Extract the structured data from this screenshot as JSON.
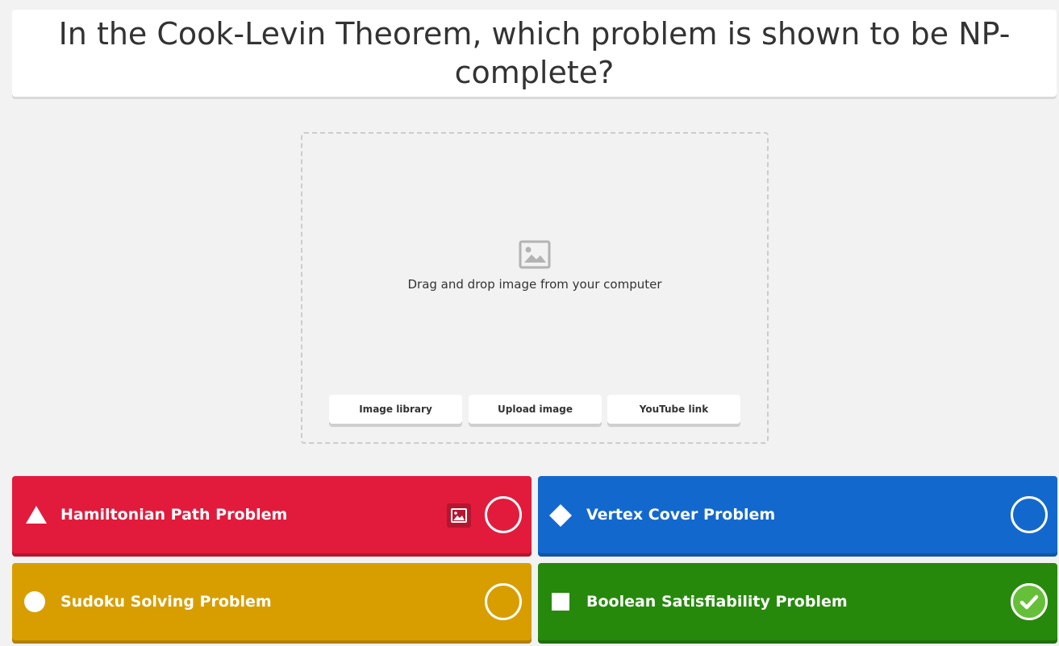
{
  "question": {
    "text": "In the Cook-Levin Theorem, which problem is shown to be NP-complete?"
  },
  "media": {
    "icon": "image-icon",
    "drop_text": "Drag and drop image from your computer",
    "buttons": {
      "image_library": "Image library",
      "upload_image": "Upload image",
      "youtube_link": "YouTube link"
    }
  },
  "answers": [
    {
      "label": "Hamiltonian Path Problem",
      "shape": "triangle-icon",
      "color": "#e21b3c",
      "correct": false
    },
    {
      "label": "Vertex Cover Problem",
      "shape": "diamond-icon",
      "color": "#1368ce",
      "correct": false
    },
    {
      "label": "Sudoku Solving Problem",
      "shape": "circle-icon",
      "color": "#d89e00",
      "correct": false
    },
    {
      "label": "Boolean Satisfiability Problem",
      "shape": "square-icon",
      "color": "#26890c",
      "correct": true
    }
  ],
  "colors": {
    "background": "#f2f2f2",
    "check_fill": "#66bf39"
  }
}
